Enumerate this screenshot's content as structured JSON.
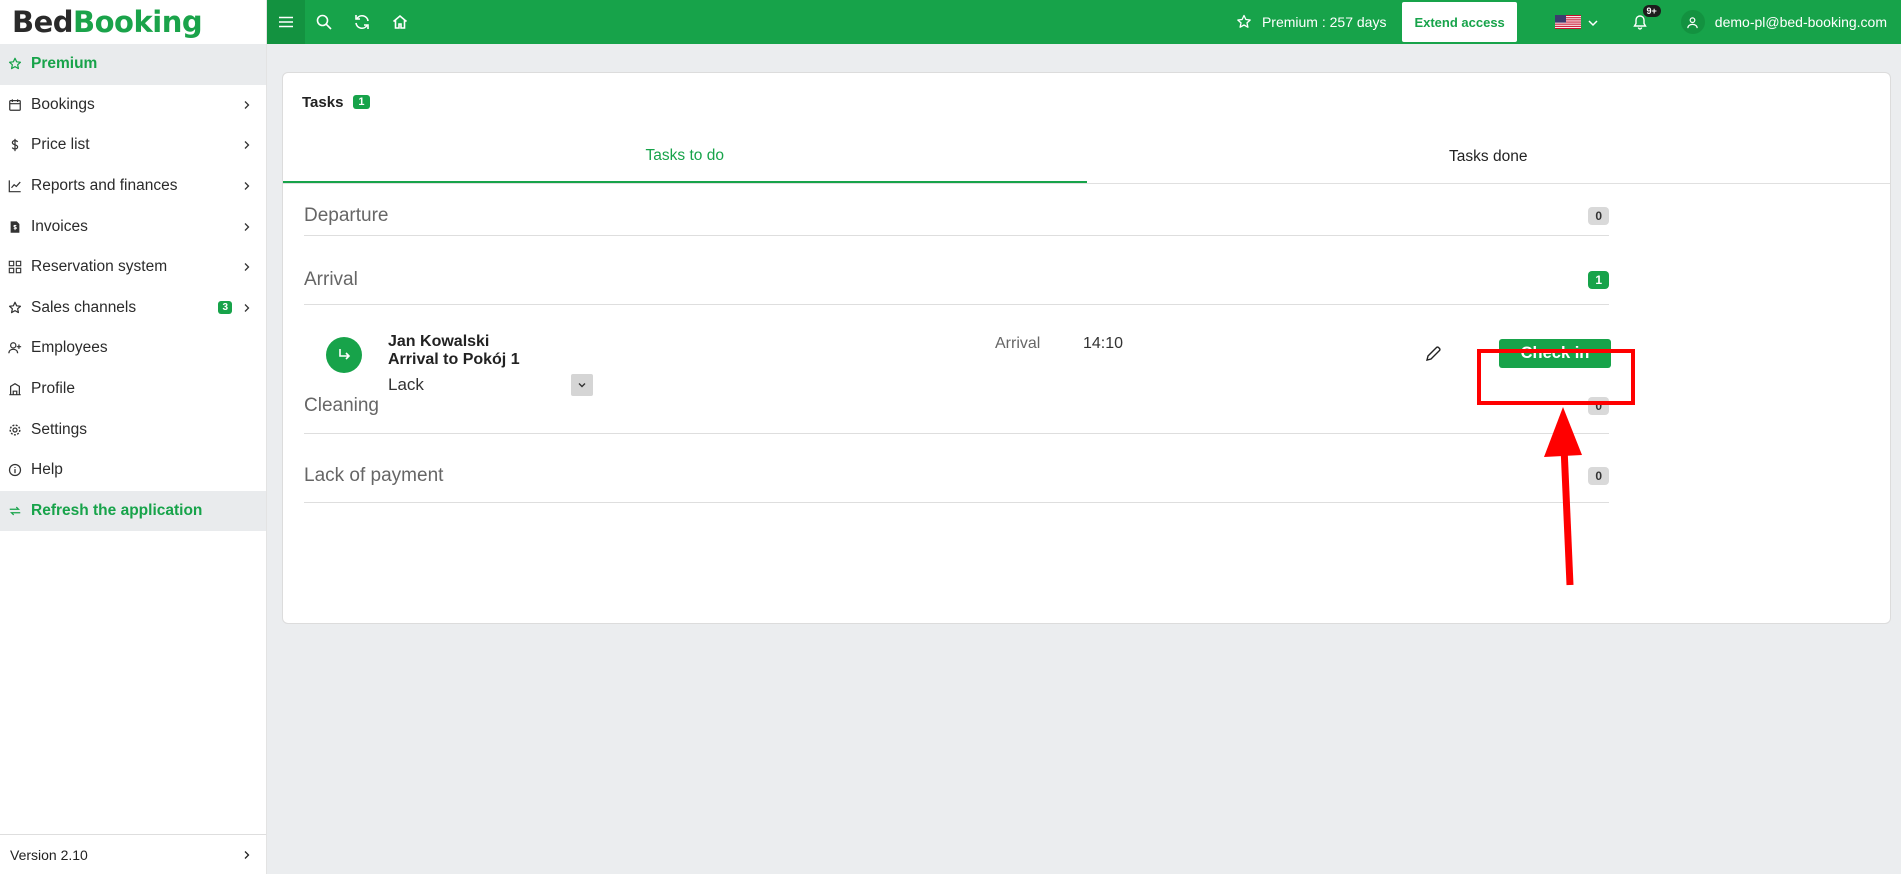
{
  "brand": {
    "part1": "Bed",
    "part2": "Booking"
  },
  "sidebar": {
    "items": [
      {
        "label": "Premium",
        "icon": "star-icon",
        "chevron": false
      },
      {
        "label": "Bookings",
        "icon": "calendar-icon",
        "chevron": true
      },
      {
        "label": "Price list",
        "icon": "dollar-icon",
        "chevron": true
      },
      {
        "label": "Reports and finances",
        "icon": "chart-icon",
        "chevron": true
      },
      {
        "label": "Invoices",
        "icon": "invoice-icon",
        "chevron": true
      },
      {
        "label": "Reservation system",
        "icon": "grid-icon",
        "chevron": true
      },
      {
        "label": "Sales channels",
        "icon": "star-icon",
        "chevron": true,
        "badge": "3"
      },
      {
        "label": "Employees",
        "icon": "user-plus-icon",
        "chevron": false
      },
      {
        "label": "Profile",
        "icon": "building-icon",
        "chevron": false
      },
      {
        "label": "Settings",
        "icon": "gear-icon",
        "chevron": false
      },
      {
        "label": "Help",
        "icon": "info-icon",
        "chevron": false
      },
      {
        "label": "Refresh the application",
        "icon": "refresh-icon",
        "chevron": false
      }
    ],
    "version": "Version 2.10"
  },
  "topbar": {
    "premium": "Premium : 257 days",
    "extend": "Extend access",
    "notifications": "9+",
    "user_email": "demo-pl@bed-booking.com"
  },
  "tasks": {
    "title": "Tasks",
    "count": "1",
    "tabs": [
      "Tasks to do",
      "Tasks done"
    ],
    "sections": {
      "departure": {
        "label": "Departure",
        "count": "0"
      },
      "arrival": {
        "label": "Arrival",
        "count": "1"
      },
      "cleaning": {
        "label": "Cleaning",
        "count": "0"
      },
      "payment": {
        "label": "Lack of payment",
        "count": "0"
      }
    },
    "arrival_task": {
      "guest": "Jan Kowalski",
      "room": "Arrival to Pokój 1",
      "status_select": "Lack",
      "type_label": "Arrival",
      "time": "14:10",
      "action": "Check in"
    }
  },
  "colors": {
    "brand_green": "#17a34a",
    "annotation_red": "#ff0000"
  }
}
